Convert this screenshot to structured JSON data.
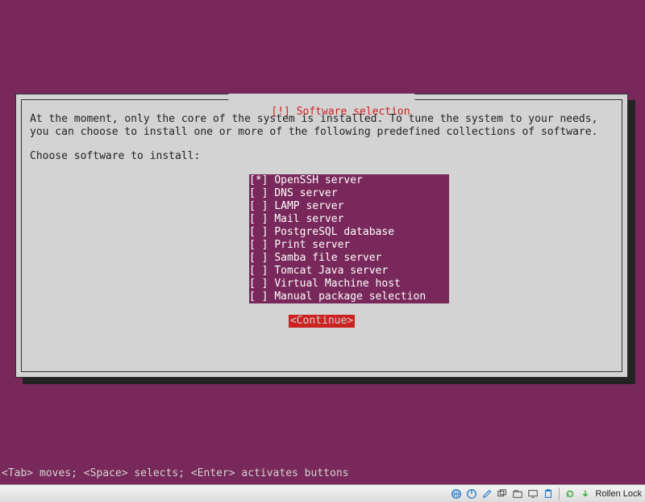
{
  "dialog": {
    "title": "[!] Software selection",
    "description": "At the moment, only the core of the system is installed. To tune the system to your needs, you can choose to install one or more of the following predefined collections of software.",
    "prompt": "Choose software to install:",
    "options": [
      {
        "label": "OpenSSH server",
        "checked": true
      },
      {
        "label": "DNS server",
        "checked": false
      },
      {
        "label": "LAMP server",
        "checked": false
      },
      {
        "label": "Mail server",
        "checked": false
      },
      {
        "label": "PostgreSQL database",
        "checked": false
      },
      {
        "label": "Print server",
        "checked": false
      },
      {
        "label": "Samba file server",
        "checked": false
      },
      {
        "label": "Tomcat Java server",
        "checked": false
      },
      {
        "label": "Virtual Machine host",
        "checked": false
      },
      {
        "label": "Manual package selection",
        "checked": false
      }
    ],
    "continue_label": "<Continue>"
  },
  "help_bar": "<Tab> moves; <Space> selects; <Enter> activates buttons",
  "taskbar": {
    "lock_text": "Rollen Lock"
  }
}
